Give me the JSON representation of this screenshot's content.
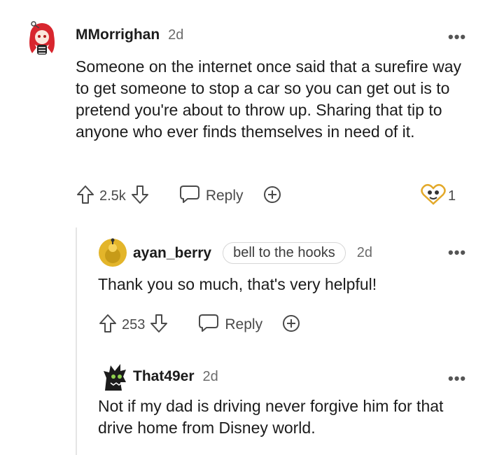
{
  "comments": [
    {
      "username": "MMorrighan",
      "time": "2d",
      "text": "Someone on the internet once said that a surefire way to get someone to stop a car so you can get out is to pretend you're about to throw up. Sharing that tip to anyone who ever finds themselves in need of it.",
      "votes": "2.5k",
      "reply_label": "Reply",
      "award_count": "1",
      "more_label": "•••"
    },
    {
      "username": "ayan_berry",
      "flair": "bell to the hooks",
      "time": "2d",
      "text": "Thank you so much, that's very helpful!",
      "votes": "253",
      "reply_label": "Reply",
      "more_label": "•••"
    },
    {
      "username": "That49er",
      "time": "2d",
      "text": "Not if my dad is driving never forgive him for that drive home from Disney world.",
      "more_label": "•••"
    }
  ],
  "colors": {
    "avatar_red": "#d8262e",
    "avatar_yellow": "#e3b52a",
    "icon_gray": "#4a4a4a"
  }
}
